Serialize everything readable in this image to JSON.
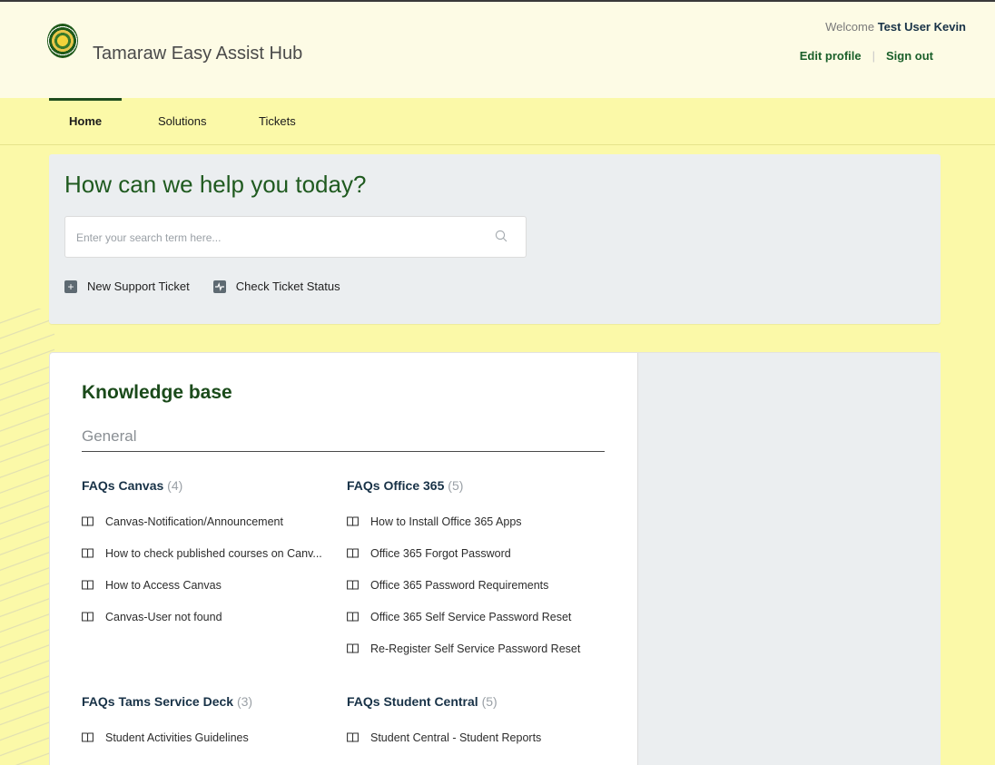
{
  "header": {
    "brand": "Tamaraw Easy Assist Hub",
    "welcome_prefix": "Welcome",
    "user_name": "Test User Kevin",
    "edit_profile": "Edit profile",
    "sign_out": "Sign out"
  },
  "nav": {
    "items": [
      {
        "label": "Home",
        "active": true
      },
      {
        "label": "Solutions"
      },
      {
        "label": "Tickets"
      }
    ]
  },
  "hero": {
    "title": "How can we help you today?",
    "search_placeholder": "Enter your search term here...",
    "new_ticket": "New Support Ticket",
    "check_status": "Check Ticket Status"
  },
  "kb": {
    "title": "Knowledge base",
    "category": "General",
    "folders": [
      {
        "name": "FAQs Canvas",
        "count": "(4)",
        "articles": [
          "Canvas-Notification/Announcement",
          "How to check published courses on Canv...",
          "How to Access Canvas",
          "Canvas-User not found"
        ]
      },
      {
        "name": "FAQs Office 365",
        "count": "(5)",
        "articles": [
          "How to Install Office 365 Apps",
          "Office 365 Forgot Password",
          "Office 365 Password Requirements",
          "Office 365 Self Service Password Reset",
          "Re-Register Self Service Password Reset"
        ]
      },
      {
        "name": "FAQs Tams Service Deck",
        "count": "(3)",
        "articles": [
          "Student Activities Guidelines"
        ]
      },
      {
        "name": "FAQs Student Central",
        "count": "(5)",
        "articles": [
          "Student Central - Student Reports"
        ]
      }
    ]
  },
  "colors": {
    "page_bg": "#fbf9a8",
    "header_bg": "#fdfbe5",
    "accent_green": "#1f5a1f",
    "panel_gray": "#ebeef0"
  }
}
